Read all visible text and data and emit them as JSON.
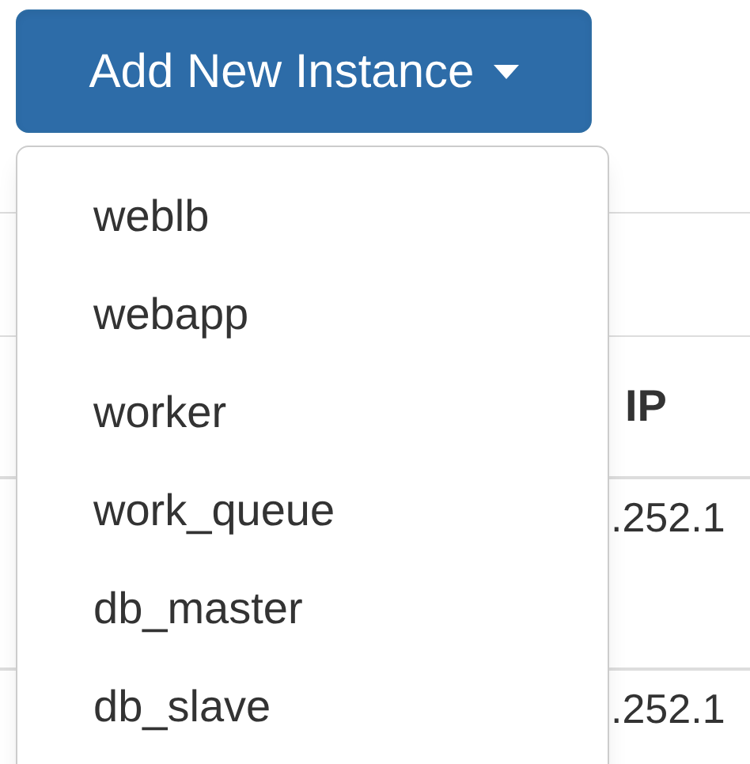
{
  "add_button": {
    "label": "Add New Instance",
    "expanded": true
  },
  "menu": {
    "items": [
      {
        "label": "weblb"
      },
      {
        "label": "webapp"
      },
      {
        "label": "worker"
      },
      {
        "label": "work_queue"
      },
      {
        "label": "db_master"
      },
      {
        "label": "db_slave"
      }
    ]
  },
  "table": {
    "columns": [
      "IP"
    ],
    "rows": [
      [
        ".252.1"
      ],
      [
        ".252.1"
      ]
    ]
  }
}
